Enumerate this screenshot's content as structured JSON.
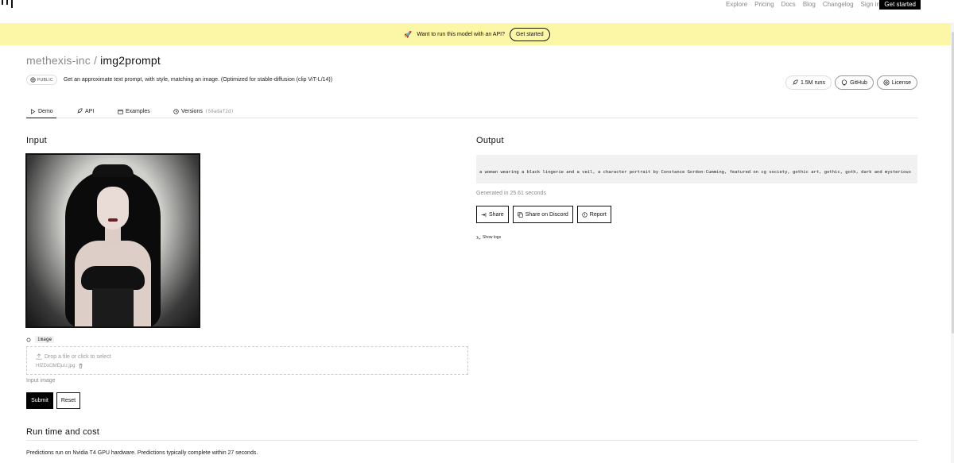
{
  "nav": {
    "links": [
      "Explore",
      "Pricing",
      "Docs",
      "Blog",
      "Changelog",
      "Sign in"
    ],
    "cta": "Get started"
  },
  "banner": {
    "text": "Want to run this model with an API?",
    "button": "Get started"
  },
  "model": {
    "owner": "methexis-inc",
    "separator": "/",
    "name": "img2prompt",
    "visibility": "PUBLIC",
    "description": "Get an approximate text prompt, with style, matching an image. (Optimized for stable-diffusion (clip ViT-L/14))"
  },
  "stats": {
    "runs": "1.5M runs",
    "github": "GitHub",
    "license": "License"
  },
  "tabs": [
    {
      "label": "Demo",
      "icon": "play-icon",
      "active": true
    },
    {
      "label": "API",
      "icon": "rocket-icon",
      "active": false
    },
    {
      "label": "Examples",
      "icon": "examples-icon",
      "active": false
    },
    {
      "label": "Versions",
      "icon": "history-icon",
      "active": false,
      "hash": "(50adaf2d)"
    }
  ],
  "input": {
    "heading": "Input",
    "field_name": "image",
    "drop_text": "Drop a file or click to select",
    "file_name": "HfZDxOMEjuU.jpg",
    "hint": "Input image",
    "submit": "Submit",
    "reset": "Reset"
  },
  "output": {
    "heading": "Output",
    "text": "a woman wearing a black lingerie and a veil, a character portrait by Constance Gordon-Cumming, featured on cg society, gothic art, gothic, goth, dark and mysterious",
    "generated": "Generated in 25.61 seconds",
    "share": "Share",
    "discord": "Share on Discord",
    "report": "Report",
    "logs": "Show logs"
  },
  "runtime": {
    "heading": "Run time and cost",
    "text": "Predictions run on Nvidia T4 GPU hardware. Predictions typically complete within 27 seconds."
  },
  "colors": {
    "banner": "#fcf6a7",
    "primary": "#000000",
    "muted": "#8a8a8a"
  }
}
